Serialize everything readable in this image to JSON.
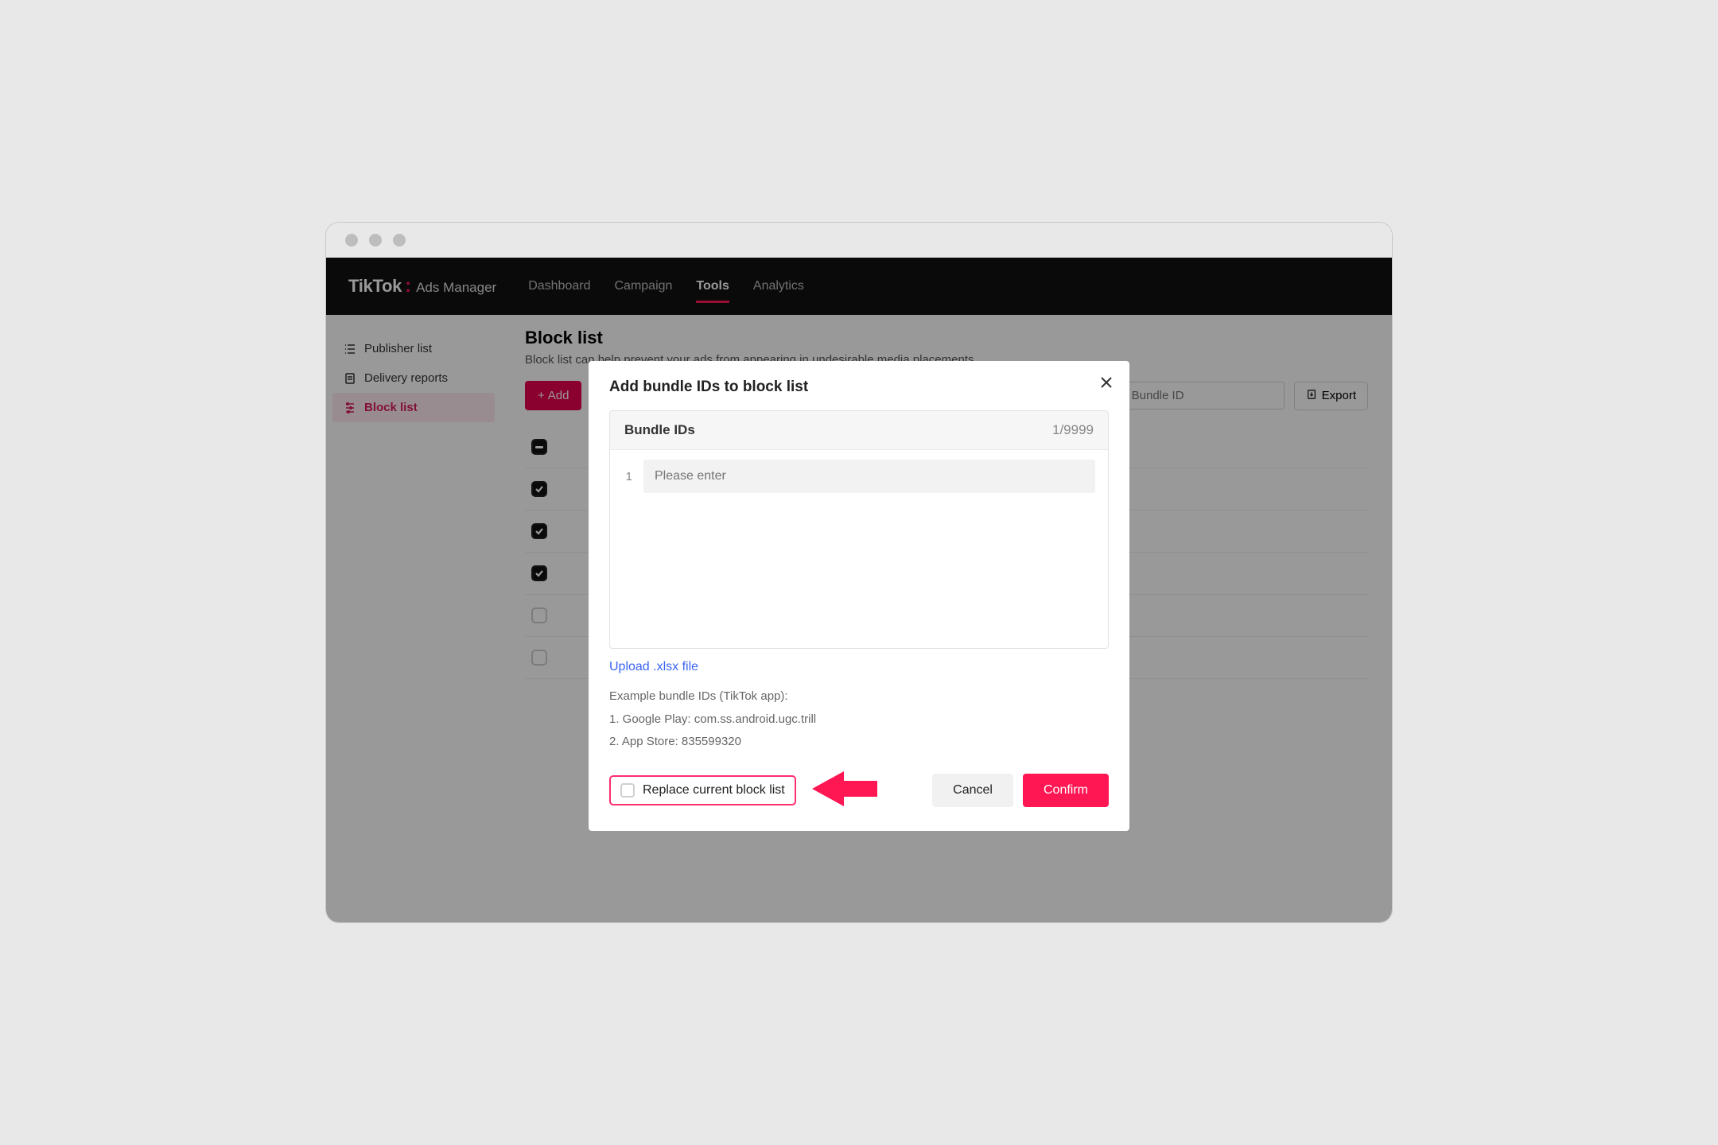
{
  "brand": {
    "name": "TikTok",
    "sub": "Ads Manager"
  },
  "nav": {
    "items": [
      {
        "label": "Dashboard"
      },
      {
        "label": "Campaign"
      },
      {
        "label": "Tools",
        "active": true
      },
      {
        "label": "Analytics"
      }
    ]
  },
  "sidebar": {
    "items": [
      {
        "label": "Publisher list"
      },
      {
        "label": "Delivery reports"
      },
      {
        "label": "Block list",
        "active": true
      }
    ]
  },
  "page": {
    "title": "Block list",
    "subtitle": "Block list can help prevent your ads from appearing in undesirable media placements."
  },
  "toolbar": {
    "add_label": "Add",
    "search_placeholder": "by Bundle ID",
    "export_label": "Export"
  },
  "list": {
    "rows": [
      {
        "state": "indeterminate"
      },
      {
        "state": "checked"
      },
      {
        "state": "checked"
      },
      {
        "state": "checked"
      },
      {
        "state": "unchecked"
      },
      {
        "state": "unchecked"
      }
    ]
  },
  "modal": {
    "title": "Add bundle IDs to block list",
    "ids_label": "Bundle IDs",
    "ids_count": "1/9999",
    "row_num": "1",
    "input_placeholder": "Please enter",
    "upload_label": "Upload .xlsx file",
    "example_heading": "Example bundle IDs (TikTok app):",
    "example_line1": "1. Google Play: com.ss.android.ugc.trill",
    "example_line2": "2. App Store: 835599320",
    "replace_label": "Replace current block list",
    "cancel_label": "Cancel",
    "confirm_label": "Confirm"
  }
}
